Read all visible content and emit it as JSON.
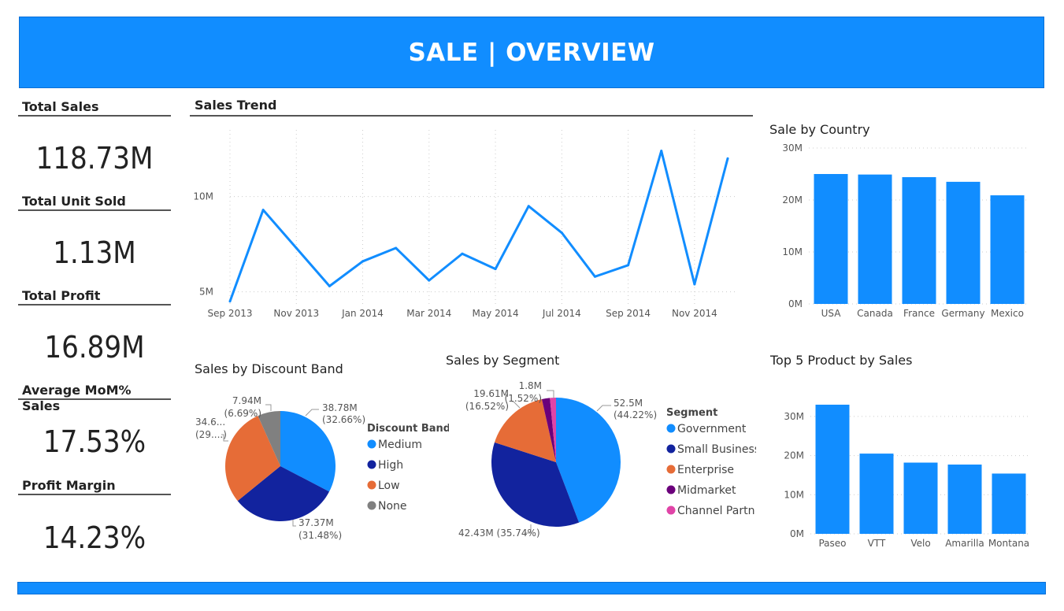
{
  "header": {
    "title": "SALE | OVERVIEW"
  },
  "kpis": [
    {
      "label": "Total Sales",
      "value": "118.73M"
    },
    {
      "label": "Total Unit Sold",
      "value": "1.13M"
    },
    {
      "label": "Total Profit",
      "value": "16.89M"
    },
    {
      "label": "Average MoM% Sales",
      "value": "17.53%"
    },
    {
      "label": "Profit Margin",
      "value": "14.23%"
    }
  ],
  "colors": {
    "accent": "#118dff",
    "navy": "#12239e",
    "orange": "#e66c37",
    "gray": "#808080",
    "purple": "#6b007b",
    "pink": "#e044a7"
  },
  "chart_data": [
    {
      "type": "line",
      "title": "Sales Trend",
      "x": [
        "Sep 2013",
        "Oct 2013",
        "Nov 2013",
        "Dec 2013",
        "Jan 2014",
        "Feb 2014",
        "Mar 2014",
        "Apr 2014",
        "May 2014",
        "Jun 2014",
        "Jul 2014",
        "Aug 2014",
        "Sep 2014",
        "Oct 2014",
        "Nov 2014",
        "Dec 2014"
      ],
      "x_tick_labels": [
        "Sep 2013",
        "Nov 2013",
        "Jan 2014",
        "Mar 2014",
        "May 2014",
        "Jul 2014",
        "Sep 2014",
        "Nov 2014"
      ],
      "values": [
        4.5,
        9.3,
        7.3,
        5.3,
        6.6,
        7.3,
        5.6,
        7.0,
        6.2,
        9.5,
        8.1,
        5.8,
        6.4,
        12.4,
        5.4,
        12.0
      ],
      "y_ticks": [
        "5M",
        "10M"
      ],
      "ylim": [
        4.2,
        13.5
      ],
      "grid": true
    },
    {
      "type": "bar",
      "title": "Sale by Country",
      "categories": [
        "USA",
        "Canada",
        "France",
        "Germany",
        "Mexico"
      ],
      "values": [
        25.0,
        24.9,
        24.4,
        23.5,
        20.9
      ],
      "y_ticks": [
        "0M",
        "10M",
        "20M",
        "30M"
      ],
      "ylim": [
        0,
        30
      ],
      "grid": true
    },
    {
      "type": "pie",
      "title": "Sales by Discount Band",
      "legend_title": "Discount Band",
      "legend_position": "right",
      "slices": [
        {
          "name": "Medium",
          "value": 38.78,
          "label_value": "38.78M",
          "label_pct": "(32.66%)"
        },
        {
          "name": "High",
          "value": 37.37,
          "label_value": "37.37M",
          "label_pct": "(31.48%)"
        },
        {
          "name": "Low",
          "value": 34.64,
          "label_value": "34.6...",
          "label_pct": "(29....)"
        },
        {
          "name": "None",
          "value": 7.94,
          "label_value": "7.94M",
          "label_pct": "(6.69%)"
        }
      ]
    },
    {
      "type": "pie",
      "title": "Sales by Segment",
      "legend_title": "Segment",
      "legend_position": "right",
      "slices": [
        {
          "name": "Government",
          "value": 52.5,
          "label": "52.5M (44.22%)"
        },
        {
          "name": "Small Business",
          "value": 42.43,
          "label": "42.43M (35.74%)"
        },
        {
          "name": "Enterprise",
          "value": 19.61,
          "label": "19.61M (16.52%)"
        },
        {
          "name": "Midmarket",
          "value": 2.39,
          "label": ""
        },
        {
          "name": "Channel Partn...",
          "value": 1.8,
          "label": "1.8M (1.52%)"
        }
      ]
    },
    {
      "type": "bar",
      "title": "Top 5 Product by Sales",
      "categories": [
        "Paseo",
        "VTT",
        "Velo",
        "Amarilla",
        "Montana"
      ],
      "values": [
        33.0,
        20.5,
        18.2,
        17.7,
        15.4
      ],
      "y_ticks": [
        "0M",
        "10M",
        "20M",
        "30M"
      ],
      "ylim": [
        0,
        34
      ],
      "grid": true
    }
  ]
}
